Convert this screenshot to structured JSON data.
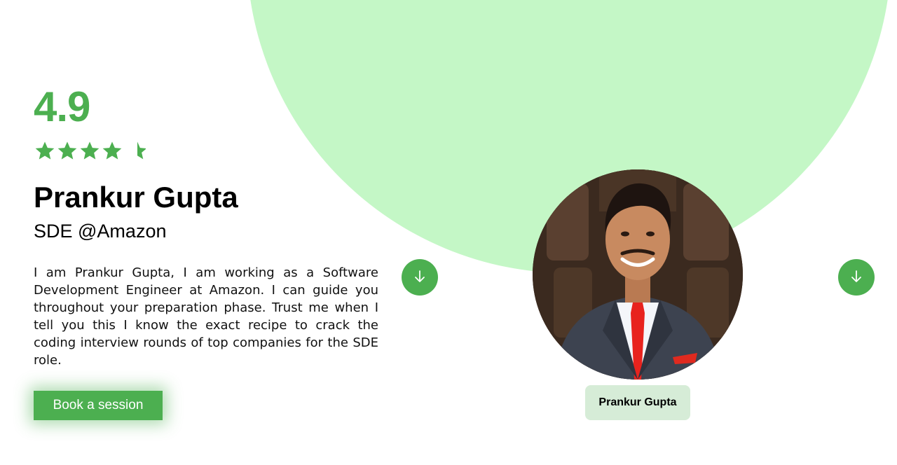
{
  "profile": {
    "rating": "4.9",
    "rating_stars": 4.5,
    "name": "Prankur Gupta",
    "role": "SDE @Amazon",
    "bio": "I am Prankur Gupta, I am working as a Software Development Engineer at Amazon. I can guide you throughout your preparation phase. Trust me when I tell you this I know the exact recipe to crack the coding interview rounds of top companies for the SDE role.",
    "cta_label": "Book a session"
  },
  "carousel": {
    "card_name": "Prankur Gupta",
    "prev_icon": "arrow-down-icon",
    "next_icon": "arrow-down-icon"
  },
  "colors": {
    "accent": "#4caf50",
    "blob": "#c4f7c6",
    "chip": "#d6ecd7"
  }
}
